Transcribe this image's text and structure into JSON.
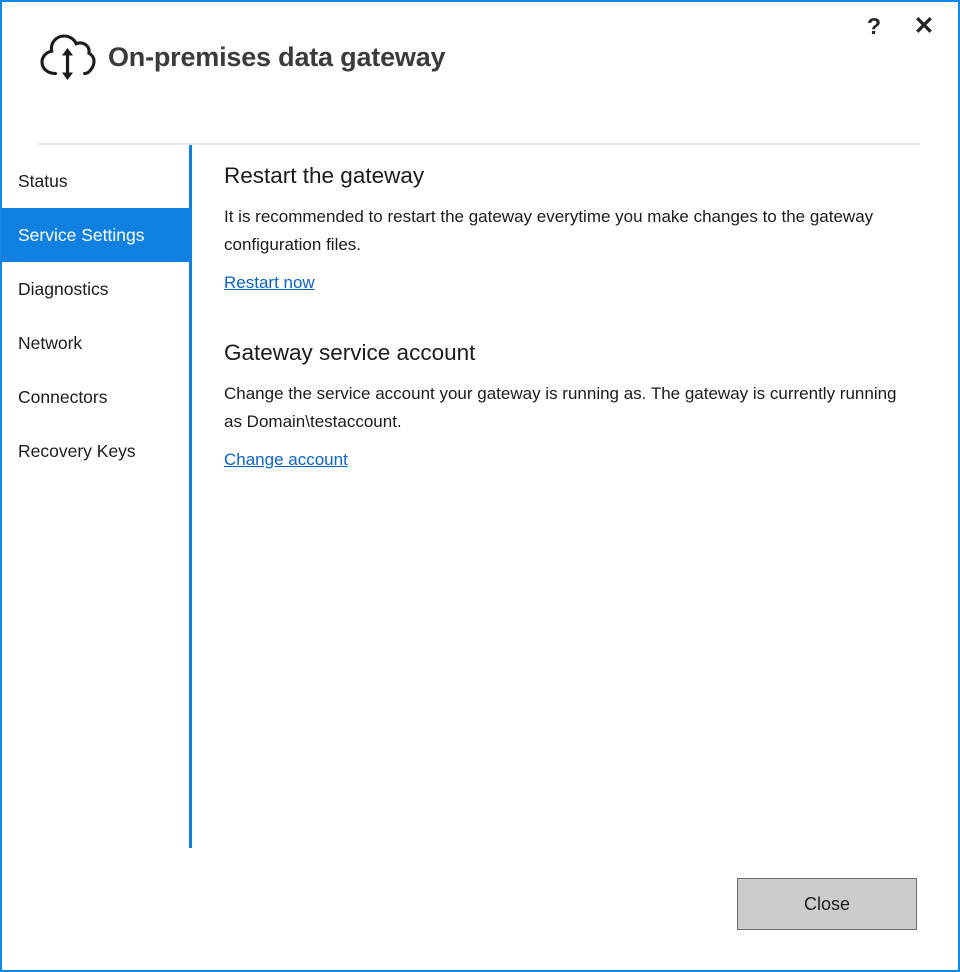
{
  "window": {
    "title": "On-premises data gateway",
    "icon": "cloud-updown-arrow-icon",
    "border_color": "#1288e6",
    "controls": {
      "help_label": "?",
      "close_label": "✕"
    }
  },
  "sidebar": {
    "selected_index": 1,
    "accent_color": "#0f80e0",
    "items": [
      {
        "label": "Status",
        "name": "status"
      },
      {
        "label": "Service Settings",
        "name": "service-settings"
      },
      {
        "label": "Diagnostics",
        "name": "diagnostics"
      },
      {
        "label": "Network",
        "name": "network"
      },
      {
        "label": "Connectors",
        "name": "connectors"
      },
      {
        "label": "Recovery Keys",
        "name": "recovery-keys"
      }
    ]
  },
  "content": {
    "restart_section": {
      "title": "Restart the gateway",
      "body": "It is recommended to restart the gateway everytime you make changes to the gateway configuration files.",
      "link": "Restart now"
    },
    "service_account_section": {
      "title": "Gateway service account",
      "body": "Change the service account your gateway is running as. The gateway is currently running as Domain\\testaccount.",
      "link": "Change account"
    }
  },
  "footer": {
    "close_label": "Close"
  }
}
